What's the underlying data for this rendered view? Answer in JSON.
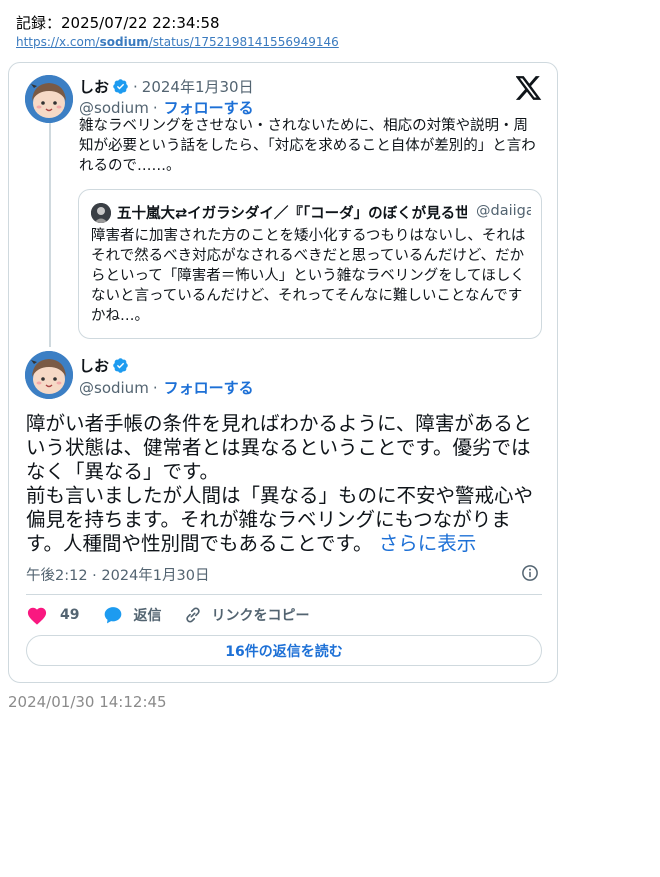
{
  "record": {
    "label": "記録：2025/07/22 22:34:58",
    "url_prefix": "https://x.com/",
    "url_user": "sodium",
    "url_suffix": "/status/1752198141556949146"
  },
  "tweet1": {
    "name": "しお",
    "date_sep": "·",
    "date": "2024年1月30日",
    "handle": "@sodium",
    "handle_sep": "·",
    "follow": "フォローする",
    "text": "雑なラベリングをさせない・されないために、相応の対策や説明・周知が必要という話をしたら、「対応を求めること自体が差別的」と言われるので……。"
  },
  "quote": {
    "name": "五十嵐大⇄イガラシダイ／『「コーダ」のぼくが見る世界』発売中",
    "handle": "@daiigarashi",
    "text": "障害者に加害された方のことを矮小化するつもりはないし、それはそれで然るべき対応がなされるべきだと思っているんだけど、だからといって「障害者＝怖い人」という雑なラベリングをしてほしくないと言っているんだけど、それってそんなに難しいことなんですかね…。"
  },
  "tweet2": {
    "name": "しお",
    "handle": "@sodium",
    "handle_sep": "·",
    "follow": "フォローする",
    "text_p1": "障がい者手帳の条件を見ればわかるように、障害があるという状態は、健常者とは異なるということです。優劣ではなく「異なる」です。",
    "text_p2": "前も言いましたが人間は「異なる」ものに不安や警戒心や偏見を持ちます。それが雑なラベリングにもつながります。人種間や性別間でもあることです。",
    "show_more": "さらに表示",
    "timestamp": "午後2:12 · 2024年1月30日"
  },
  "actions": {
    "like_count": "49",
    "reply_label": "返信",
    "copy_label": "リンクをコピー",
    "read_replies": "16件の返信を読む"
  },
  "footer": {
    "date": "2024/01/30 14:12:45"
  },
  "colors": {
    "accent": "#1d70d6",
    "like": "#f91880",
    "reply": "#1d9bf0",
    "muted": "#536471",
    "border": "#cfd9de"
  },
  "icons": [
    "verified-badge-icon",
    "x-logo-icon",
    "info-icon",
    "heart-icon",
    "reply-bubble-icon",
    "link-icon"
  ]
}
